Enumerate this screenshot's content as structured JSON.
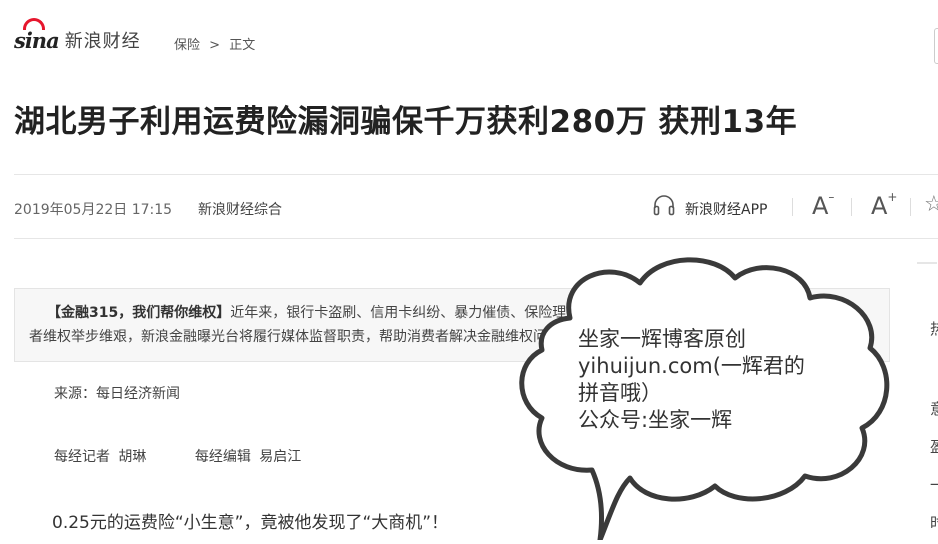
{
  "header": {
    "logo_text": "新浪财经",
    "logo_mark": "sina",
    "breadcrumb": [
      "保险",
      ">",
      "正文"
    ]
  },
  "article": {
    "title": "湖北男子利用运费险漏洞骗保千万获利280万 获刑13年",
    "date": "2019年05月22日 17:15",
    "source": "新浪财经综合",
    "app_label": "新浪财经APP",
    "font_decrease": "A",
    "font_increase": "A",
    "notice_title": "【金融315，我们帮你维权】",
    "notice_line1": "近年来，银行卡盗刷、信用卡纠纷、暴力催债、保险理赔难等问题层出不穷，金融消费",
    "notice_line2": "者维权举步维艰，新浪金融曝光台将履行媒体监督职责，帮助消费者解决金融维权问题【我要投诉】",
    "from": "来源：每日经济新闻",
    "reporter": "每经记者 胡琳",
    "editor": "每经编辑 易启江",
    "lead": "0.25元的运费险“小生意”，竟被他发现了“大商机”！"
  },
  "sidebar": {
    "chars": [
      "热",
      "意",
      "盈",
      "一",
      "时",
      "事"
    ]
  },
  "watermark": {
    "line1": "坐家一辉博客原创",
    "line2": "yihuijun.com(一辉君的",
    "line3": "拼音哦）",
    "line4": "公众号:坐家一辉"
  },
  "colors": {
    "brand_red": "#e6162d",
    "title": "#222222",
    "notice_bg": "#f7f7f7"
  },
  "icons": {
    "app": "headphones-icon",
    "font_minus": "font-decrease-icon",
    "font_plus": "font-increase-icon",
    "favorite": "star-icon"
  }
}
